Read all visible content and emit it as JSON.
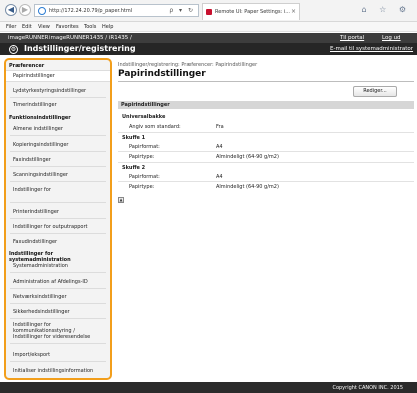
{
  "browser": {
    "url": "http://172.24.20.79/p_paper.html",
    "tab_title": "Remote UI: Paper Settings: i...",
    "tab_close": "×",
    "back_glyph": "◀",
    "forward_glyph": "▶",
    "tools_glyphs": "ρ ▾ ↻",
    "icons_glyphs": "⌂ ☆ ⚙",
    "menu": [
      "Filer",
      "Edit",
      "View",
      "Favorites",
      "Tools",
      "Help"
    ]
  },
  "header": {
    "brand": "imageRUNNER",
    "model": "imageRUNNER1435 / iR1435 /",
    "portal_link": "Til portal",
    "logout_link": "Log ud",
    "gear_glyph": "⚙",
    "section": "Indstillinger/registrering",
    "email_link": "E-mail til systemadministrator"
  },
  "sidebar": {
    "group1": "Præferencer",
    "items1": [
      "Papirindstillinger",
      "Lydstyrkestyringsindstillinger",
      "Timerindstillinger"
    ],
    "group2": "Funktionsindstillinger",
    "items2": [
      "Almene indstillinger",
      "Kopieringsindstillinger",
      "Faxindstillinger",
      "Scanningsindstillinger",
      "Indstillinger for",
      "Printerindstillinger",
      "Indstillinger for outputrapport",
      "Faxudindstillinger"
    ],
    "group3": "Indstillinger for systemadministration",
    "items3": [
      "Systemadministration",
      "Administration af Afdelings-ID",
      "Netværksindstillinger",
      "Sikkerhedsindstillinger"
    ],
    "multi_item": [
      "Indstillinger for",
      "kommunikationsstyring /",
      "Indstillinger for videresendelse"
    ],
    "items4": [
      "Import/eksport",
      "Initialiser indstillingsinformation"
    ]
  },
  "main": {
    "breadcrumb": "Indstillinger/registrering: Præferencer: Papirindstillinger",
    "title": "Papirindstillinger",
    "edit_button": "Rediger...",
    "section_title": "Papirindstillinger",
    "groups": [
      {
        "name": "Universalbakke",
        "rows": [
          {
            "label": "Angiv som standard:",
            "value": "Fra"
          }
        ]
      },
      {
        "name": "Skuffe 1",
        "rows": [
          {
            "label": "Papirformat:",
            "value": "A4"
          },
          {
            "label": "Papirtype:",
            "value": "Almindeligt (64-90 g/m2)"
          }
        ]
      },
      {
        "name": "Skuffe 2",
        "rows": [
          {
            "label": "Papirformat:",
            "value": "A4"
          },
          {
            "label": "Papirtype:",
            "value": "Almindeligt (64-90 g/m2)"
          }
        ]
      }
    ],
    "top_glyph": "▲"
  },
  "footer": {
    "copyright": "Copyright CANON INC. 2015"
  },
  "colors": {
    "sidebar_highlight": "#f29e1b",
    "header_dark": "#262626",
    "section_bar": "#d6d6d6"
  }
}
